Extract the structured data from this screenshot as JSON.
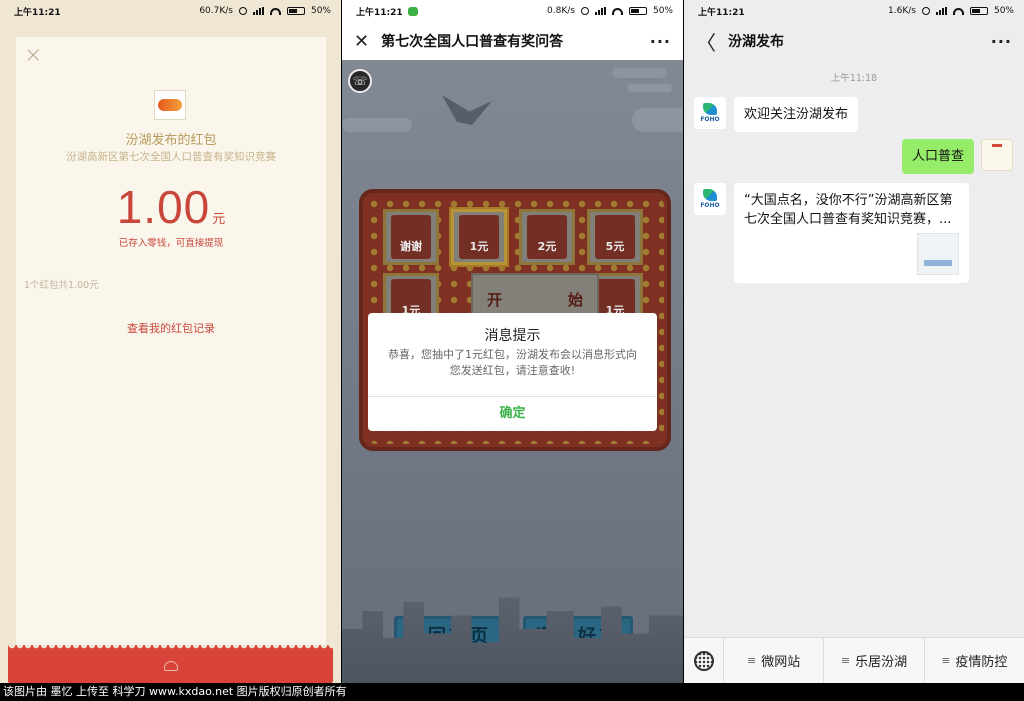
{
  "panel1": {
    "status": {
      "time": "上午11:21",
      "speed": "60.7K/s",
      "battery": "50%"
    },
    "title": "汾湖发布的红包",
    "subtitle": "汾湖高新区第七次全国人口普查有奖知识竞赛",
    "amount": "1.00",
    "unit": "元",
    "note": "已存入零钱，可直接提现",
    "count": "1个红包共1.00元",
    "record_link": "查看我的红包记录",
    "close_icon": "×"
  },
  "panel2": {
    "status": {
      "time": "上午11:21",
      "speed": "0.8K/s",
      "battery": "50%"
    },
    "nav": {
      "close": "✕",
      "title": "第七次全国人口普查有奖问答",
      "more": "···"
    },
    "grid": [
      {
        "label": "谢谢",
        "selected": false
      },
      {
        "label": "1元",
        "selected": true
      },
      {
        "label": "2元",
        "selected": false
      },
      {
        "label": "5元",
        "selected": false
      },
      {
        "label": "1元",
        "selected": false
      },
      {
        "label": "1元",
        "selected": false
      }
    ],
    "start": {
      "left": "开",
      "right": "始"
    },
    "dialog": {
      "title": "消息提示",
      "body": "恭喜，您抽中了1元红包，汾湖发布会以消息形式向您发送红包，请注意查收!",
      "ok": "确定"
    },
    "buttons": {
      "home": "返回首页",
      "invite": "邀请好友"
    }
  },
  "panel3": {
    "status": {
      "time": "上午11:21",
      "speed": "1.6K/s",
      "battery": "50%"
    },
    "nav": {
      "back": "〈",
      "title": "汾湖发布",
      "more": "···"
    },
    "chat_time": "上午11:18",
    "avatar_text": "FOHO",
    "messages": {
      "welcome": "欢迎关注汾湖发布",
      "mine": "人口普查",
      "article": "“大国点名，没你不行”汾湖高新区第七次全国人口普查有奖知识竞赛，..."
    },
    "menu": [
      "微网站",
      "乐居汾湖",
      "疫情防控"
    ]
  },
  "footer": "该图片由 墨忆 上传至 科学刀 www.kxdao.net 图片版权归原创者所有"
}
